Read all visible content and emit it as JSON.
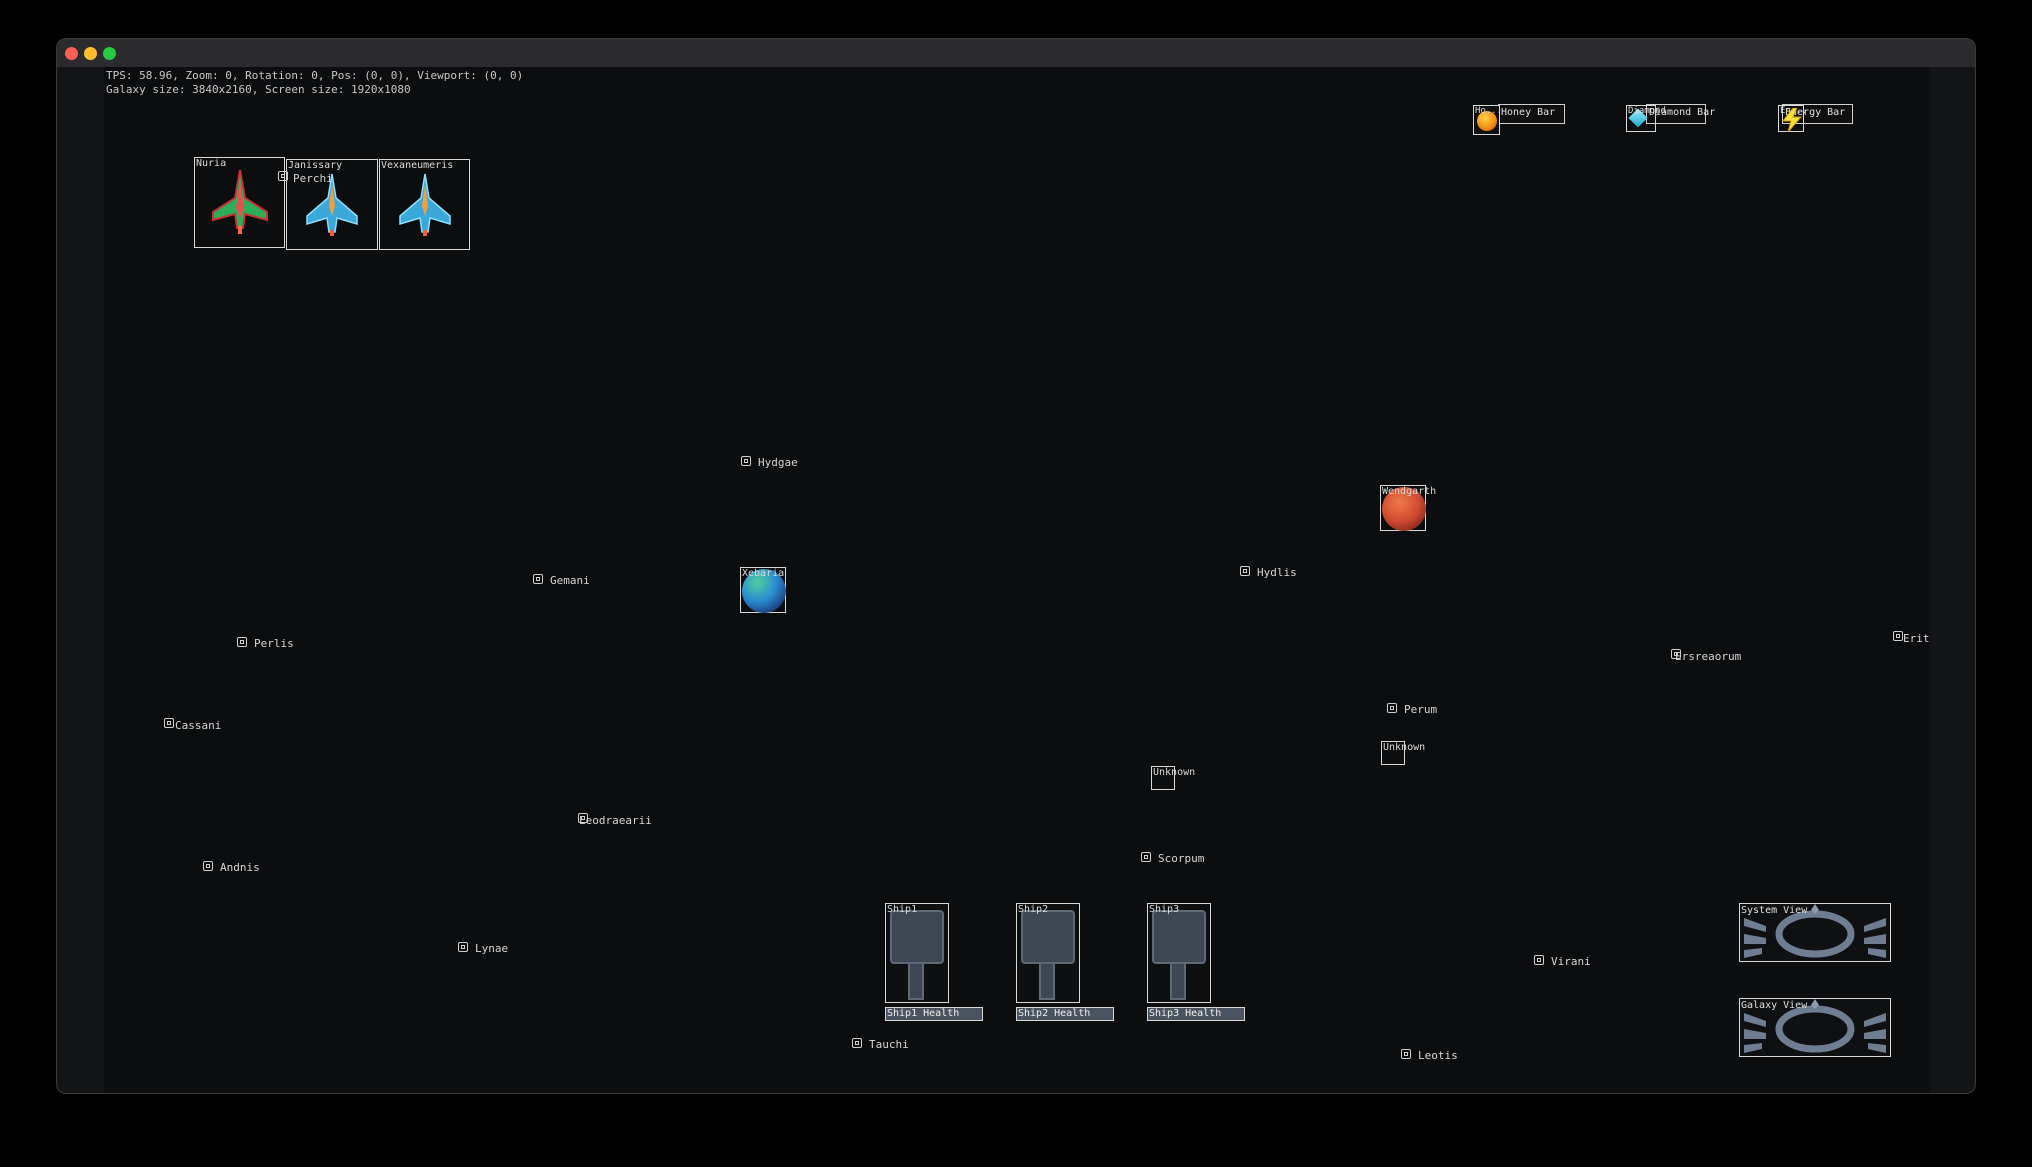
{
  "hud": {
    "line1": "TPS: 58.96, Zoom: 0, Rotation: 0, Pos: (0, 0), Viewport: (0, 0)",
    "line2": "Galaxy size: 3840x2160, Screen size: 1920x1080"
  },
  "resources": [
    {
      "name": "Honey Bar",
      "icon": "honey-orb-icon",
      "icon_label": "Ho..."
    },
    {
      "name": "Diamond Bar",
      "icon": "diamond-icon",
      "icon_label": "Diamond"
    },
    {
      "name": "Energy Bar",
      "icon": "energy-bolt-icon",
      "icon_label": "En..."
    }
  ],
  "ships_top": [
    {
      "name": "Nuria",
      "color": "#e04545"
    },
    {
      "name": "Janissary",
      "color": "#40b0e0"
    },
    {
      "name": "Vexaneumeris",
      "color": "#40b0e0"
    }
  ],
  "overlap_label": "Perchi",
  "planets": [
    {
      "name": "Xebaria",
      "colors": [
        "#2a8bd0",
        "#1c3a7a"
      ]
    },
    {
      "name": "Wendgarth",
      "colors": [
        "#e05a3a",
        "#7a2418"
      ]
    }
  ],
  "systems": [
    "Hydgae",
    "Gemani",
    "Hydlis",
    "Perlis",
    "Ersreaorum",
    "Erit",
    "Cassani",
    "Perum",
    "Leodraearii",
    "Scorpum",
    "Andnis",
    "Lynae",
    "Virani",
    "Tauchi",
    "Leotis"
  ],
  "unknowns": [
    "Unknown",
    "Unknown"
  ],
  "fleet": [
    {
      "name": "Ship1",
      "health_label": "Ship1 Health",
      "health": 1.0
    },
    {
      "name": "Ship2",
      "health_label": "Ship2 Health",
      "health": 1.0
    },
    {
      "name": "Ship3",
      "health_label": "Ship3 Health",
      "health": 1.0
    }
  ],
  "views": {
    "system": "System View",
    "galaxy": "Galaxy View"
  }
}
